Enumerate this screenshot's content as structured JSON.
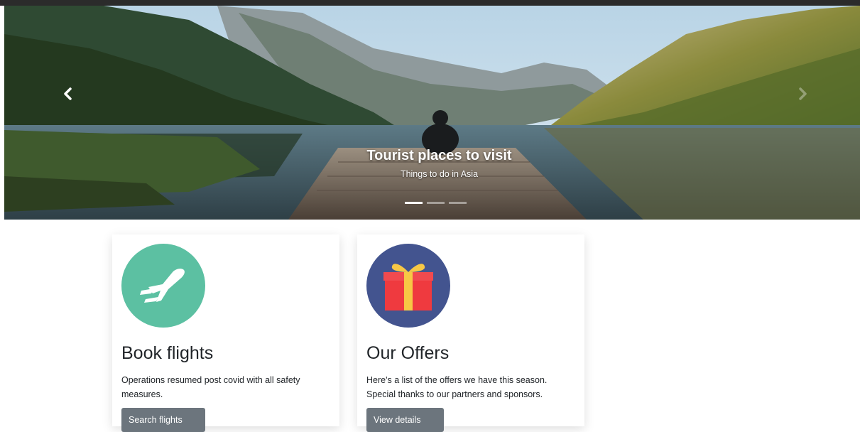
{
  "carousel": {
    "slides": [
      {
        "title": "Tourist places to visit",
        "subtitle": "Things to do in Asia"
      }
    ],
    "indicators": [
      true,
      false,
      false
    ],
    "prev_icon": "chevron-left-icon",
    "next_icon": "chevron-right-icon"
  },
  "cards": [
    {
      "icon": "airplane-icon",
      "icon_bg": "#5cc0a2",
      "title": "Book flights",
      "text": "Operations resumed post covid with all safety measures.",
      "button": "Search flights"
    },
    {
      "icon": "gift-icon",
      "icon_bg": "#43548f",
      "title": "Our Offers",
      "text": "Here's a list of the offers we have this season. Special thanks to our partners and sponsors.",
      "button": "View details"
    }
  ],
  "colors": {
    "topbar": "#2b2b2b",
    "button_bg": "#6c757d",
    "text": "#212529"
  }
}
